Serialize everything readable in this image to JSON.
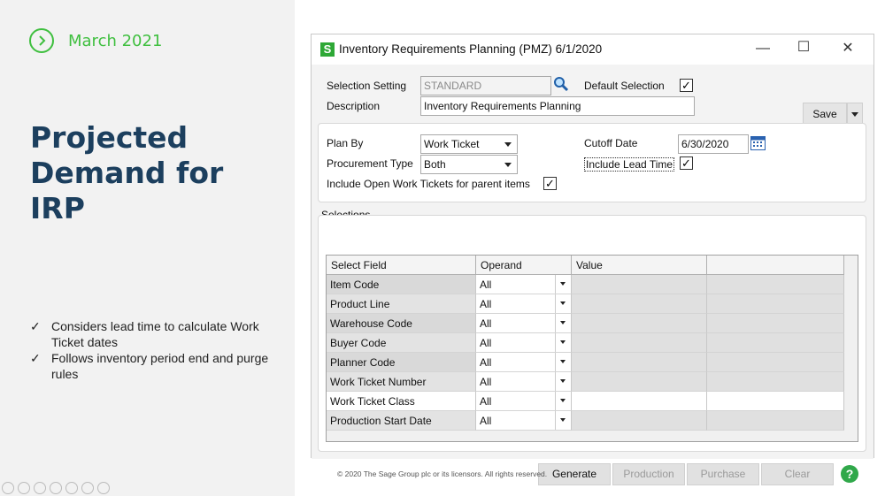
{
  "slide": {
    "date": "March 2021",
    "title": "Projected Demand for IRP",
    "bullets": [
      "Considers lead time to calculate Work Ticket dates",
      "Follows inventory period end and purge rules"
    ],
    "copyright": "© 2020 The Sage Group plc or its licensors. All rights reserved.",
    "accent_color": "#3fbf3f",
    "title_color": "#1c3f5e"
  },
  "window": {
    "app_icon": "S",
    "title": "Inventory Requirements Planning (PMZ) 6/1/2020",
    "save_label": "Save",
    "selection_setting_label": "Selection Setting",
    "selection_setting_value": "STANDARD",
    "default_selection_label": "Default Selection",
    "default_selection_checked": true,
    "description_label": "Description",
    "description_value": "Inventory Requirements Planning",
    "plan_by_label": "Plan By",
    "plan_by_value": "Work Ticket",
    "procurement_type_label": "Procurement Type",
    "procurement_type_value": "Both",
    "cutoff_date_label": "Cutoff Date",
    "cutoff_date_value": "6/30/2020",
    "include_lead_time_label": "Include Lead Time",
    "include_lead_time_checked": true,
    "include_open_label": "Include Open Work Tickets for parent items",
    "include_open_checked": true,
    "selections_label": "Selections",
    "grid": {
      "headers": [
        "Select Field",
        "Operand",
        "Value",
        ""
      ],
      "rows": [
        {
          "field": "Item Code",
          "operand": "All"
        },
        {
          "field": "Product Line",
          "operand": "All"
        },
        {
          "field": "Warehouse Code",
          "operand": "All"
        },
        {
          "field": "Buyer Code",
          "operand": "All"
        },
        {
          "field": "Planner Code",
          "operand": "All"
        },
        {
          "field": "Work Ticket Number",
          "operand": "All"
        },
        {
          "field": "Work Ticket Class",
          "operand": "All"
        },
        {
          "field": "Production Start Date",
          "operand": "All"
        }
      ]
    },
    "buttons": {
      "generate": "Generate",
      "production": "Production",
      "purchase": "Purchase",
      "clear": "Clear",
      "help": "?"
    }
  }
}
